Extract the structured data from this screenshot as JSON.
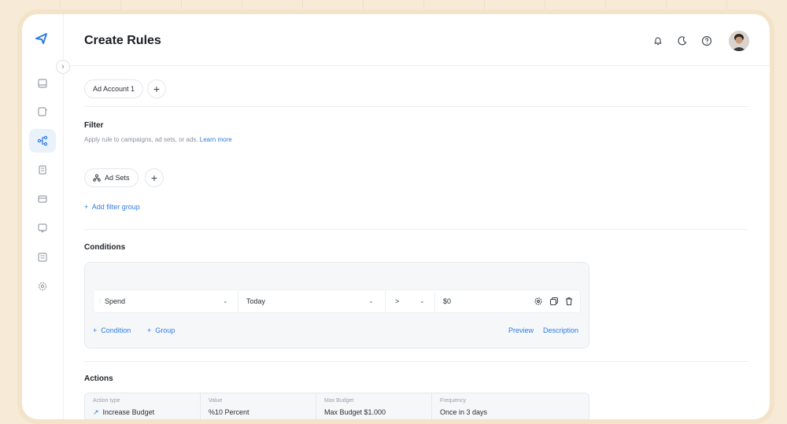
{
  "page": {
    "title": "Create Rules"
  },
  "account": {
    "pill_label": "Ad Account 1"
  },
  "filter": {
    "title": "Filter",
    "description": "Apply rule to campaigns, ad sets, or ads.",
    "learn_more": "Learn more",
    "pill_label": "Ad Sets",
    "add_group": "Add filter group"
  },
  "conditions": {
    "title": "Conditions",
    "row": {
      "metric": "Spend",
      "period": "Today",
      "operator": ">",
      "value": "$0"
    },
    "add_condition": "Condition",
    "add_group": "Group",
    "preview": "Preview",
    "description": "Description"
  },
  "actions": {
    "title": "Actions",
    "columns": [
      {
        "label": "Action type",
        "value": "Increase Budget"
      },
      {
        "label": "Value",
        "value": "%10 Percent"
      },
      {
        "label": "Max Budget",
        "value": "Max Budget $1.000"
      },
      {
        "label": "Frequency",
        "value": "Once in 3 days"
      }
    ]
  },
  "colors": {
    "accent": "#2f7de1",
    "frame": "#f7ead6"
  }
}
